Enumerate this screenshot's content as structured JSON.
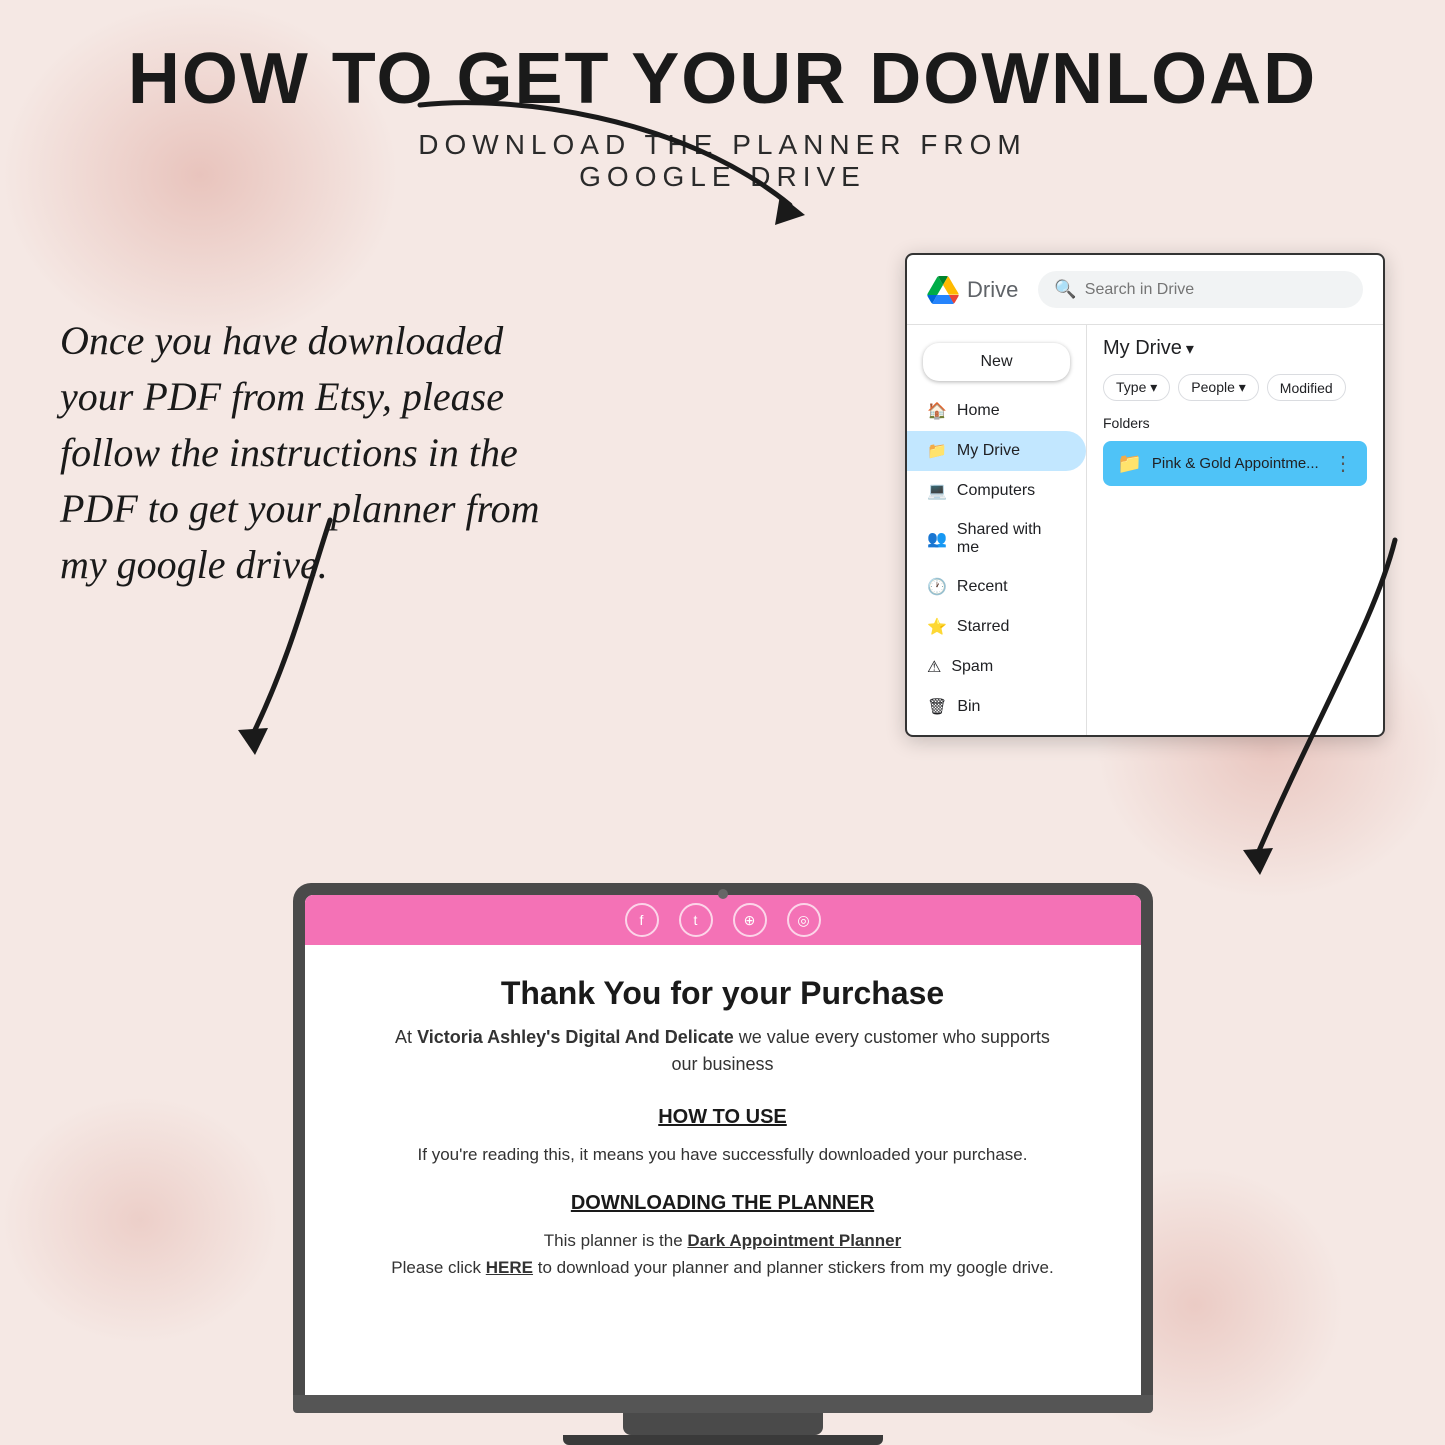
{
  "page": {
    "main_title": "HOW TO GET YOUR DOWNLOAD",
    "subtitle": "DOWNLOAD THE PLANNER FROM\nGOOGLE DRIVE"
  },
  "left_text": {
    "body": "Once you have downloaded your PDF from Etsy, please follow the instructions in the PDF to get your planner from my google drive."
  },
  "drive_popup": {
    "title": "Drive",
    "search_placeholder": "Search in Drive",
    "new_button": "New",
    "my_drive_label": "My Drive",
    "sidebar_items": [
      {
        "label": "Home",
        "icon": "home"
      },
      {
        "label": "My Drive",
        "icon": "folder",
        "active": true
      },
      {
        "label": "Computers",
        "icon": "computer"
      },
      {
        "label": "Shared with me",
        "icon": "people"
      },
      {
        "label": "Recent",
        "icon": "clock"
      },
      {
        "label": "Starred",
        "icon": "star"
      },
      {
        "label": "Spam",
        "icon": "warning"
      },
      {
        "label": "Bin",
        "icon": "trash"
      }
    ],
    "filters": [
      {
        "label": "Type ▾"
      },
      {
        "label": "People ▾"
      },
      {
        "label": "Modified"
      }
    ],
    "folders_label": "Folders",
    "folder_name": "Pink & Gold Appointme..."
  },
  "laptop": {
    "screen": {
      "title": "Thank You for your Purchase",
      "subtitle_start": "At ",
      "subtitle_bold": "Victoria Ashley's Digital And Delicate",
      "subtitle_end": " we value every customer who supports our business",
      "section1_title": "HOW TO USE",
      "section1_body": "If you're reading this, it means you have successfully downloaded your purchase.",
      "section2_title": "DOWNLOADING THE PLANNER",
      "section2_body_start": "This planner is the ",
      "section2_body_link1": "Dark Appointment Planner",
      "section2_body_mid": "\nPlease click ",
      "section2_body_link2": "HERE",
      "section2_body_end": " to download your planner and planner stickers from my google drive."
    }
  }
}
